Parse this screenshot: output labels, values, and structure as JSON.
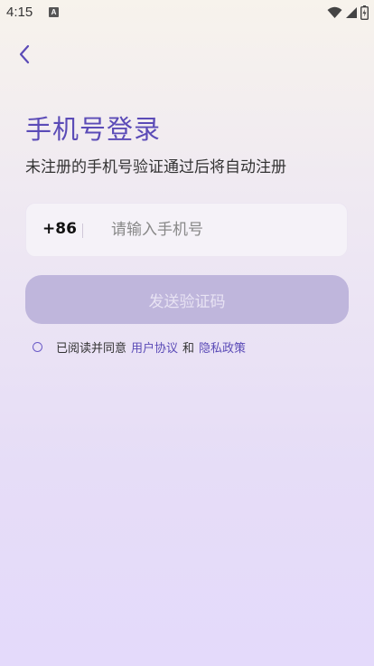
{
  "status_bar": {
    "time": "4:15",
    "notif_letter": "A"
  },
  "page": {
    "title": "手机号登录",
    "subtitle": "未注册的手机号验证通过后将自动注册"
  },
  "phone": {
    "country_code": "+86",
    "placeholder": "请输入手机号",
    "value": ""
  },
  "send_button": {
    "label": "发送验证码"
  },
  "agreement": {
    "prefix": "已阅读并同意",
    "user_agreement": "用户协议",
    "conjunction": "和",
    "privacy_policy": "隐私政策",
    "checked": false
  },
  "colors": {
    "accent": "#5b4bb7",
    "button_disabled": "#bfb6dc"
  }
}
